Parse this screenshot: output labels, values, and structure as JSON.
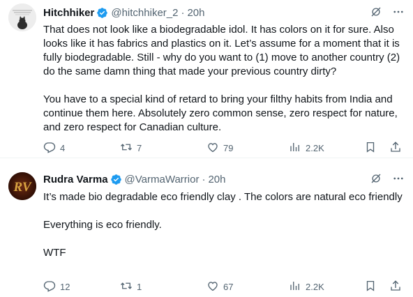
{
  "tweets": [
    {
      "author_name": "Hitchhiker",
      "handle": "@hitchhiker_2",
      "separator": "·",
      "time": "20h",
      "paragraphs": [
        "That does not look like a biodegradable idol. It has colors on it for sure. Also looks like it has fabrics and plastics on it. Let’s assume for a moment that it is fully biodegradable. Still - why do you want to (1) move to another country (2) do the same damn thing that made your previous country dirty?",
        "You have to a special kind of retard to bring your filthy habits from India and continue them here. Absolutely zero common sense, zero respect for nature, and zero respect for Canadian culture."
      ],
      "replies": "4",
      "reposts": "7",
      "likes": "79",
      "views": "2.2K"
    },
    {
      "author_name": "Rudra Varma",
      "handle": "@VarmaWarrior",
      "separator": "·",
      "time": "20h",
      "avatar_text": "RV",
      "paragraphs": [
        "It’s made bio degradable eco friendly  clay . The colors are natural eco friendly",
        "Everything is eco friendly.",
        "WTF"
      ],
      "replies": "12",
      "reposts": "1",
      "likes": "67",
      "views": "2.2K"
    }
  ],
  "icons": {
    "verified": "verified-badge-icon",
    "grok": "grok-icon",
    "more": "more-icon",
    "reply": "reply-icon",
    "repost": "repost-icon",
    "like": "like-icon",
    "views": "views-icon",
    "bookmark": "bookmark-icon",
    "share": "share-icon"
  },
  "colors": {
    "verified": "#1d9bf0",
    "secondary_text": "#536471",
    "primary_text": "#0f1419"
  }
}
